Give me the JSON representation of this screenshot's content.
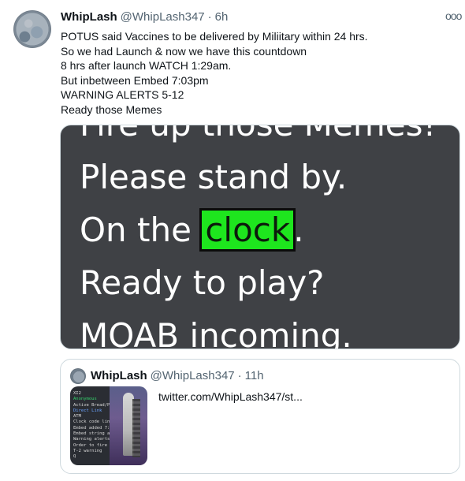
{
  "tweet": {
    "author_name": "WhipLash",
    "author_handle": "@WhipLash347",
    "time": "6h",
    "more_icon": "more-options-icon",
    "body_lines": [
      "POTUS said Vaccines to be delivered by Miliitary within 24 hrs.",
      "So we had Launch & now we have this countdown",
      "8 hrs after launch WATCH 1:29am.",
      "But inbetween Embed 7:03pm",
      "WARNING ALERTS 5-12",
      "Ready those Memes"
    ]
  },
  "media": {
    "background_color": "#3f4145",
    "highlight_color": "#1ee61e",
    "lines": {
      "line0": "Fire up those Memes!",
      "line1": "Please stand by.",
      "line2_prefix": "On the ",
      "line2_highlight": "clock",
      "line2_suffix": ".",
      "line3": "Ready to play?",
      "line4": "MOAB incoming."
    }
  },
  "quote": {
    "author_name": "WhipLash",
    "author_handle": "@WhipLash347",
    "time": "11h",
    "link_text": "twitter.com/WhipLash347/st...",
    "thumb_left_lines": [
      "XI2",
      "Anonymous",
      "Active Bread/Post L",
      "Direct Link",
      "",
      "ATM",
      "Clock code line 1182",
      "Embed added 7:03pm",
      "Embed string active i",
      "Warning alerts 5-12",
      "Order to fire will be wi",
      "T-2 warning",
      "Q"
    ]
  }
}
